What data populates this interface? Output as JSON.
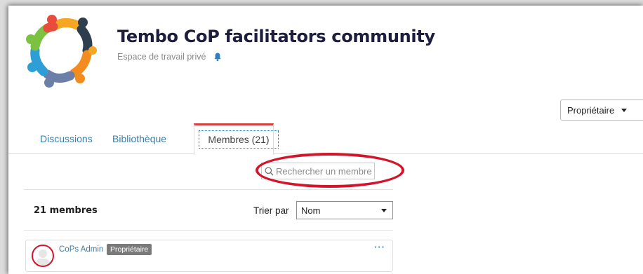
{
  "header": {
    "title": "Tembo CoP facilitators community",
    "subtitle": "Espace de travail privé"
  },
  "role_dropdown": {
    "label": "Propriétaire"
  },
  "tabs": [
    {
      "label": "Discussions"
    },
    {
      "label": "Bibliothèque"
    },
    {
      "label": "Membres (21)",
      "active": true
    }
  ],
  "search": {
    "placeholder": "Rechercher un membre"
  },
  "list": {
    "count_label": "21 membres",
    "sort_label": "Trier par",
    "sort_value": "Nom"
  },
  "members": [
    {
      "name": "CoPs Admin",
      "role": "Propriétaire"
    }
  ],
  "colors": {
    "accent": "#d6403b",
    "link": "#3a7ea8",
    "highlight": "#d3152b",
    "title": "#1d1d3f"
  },
  "icons": {
    "notification": "bell-icon",
    "search": "search-icon",
    "more": "more-icon"
  }
}
